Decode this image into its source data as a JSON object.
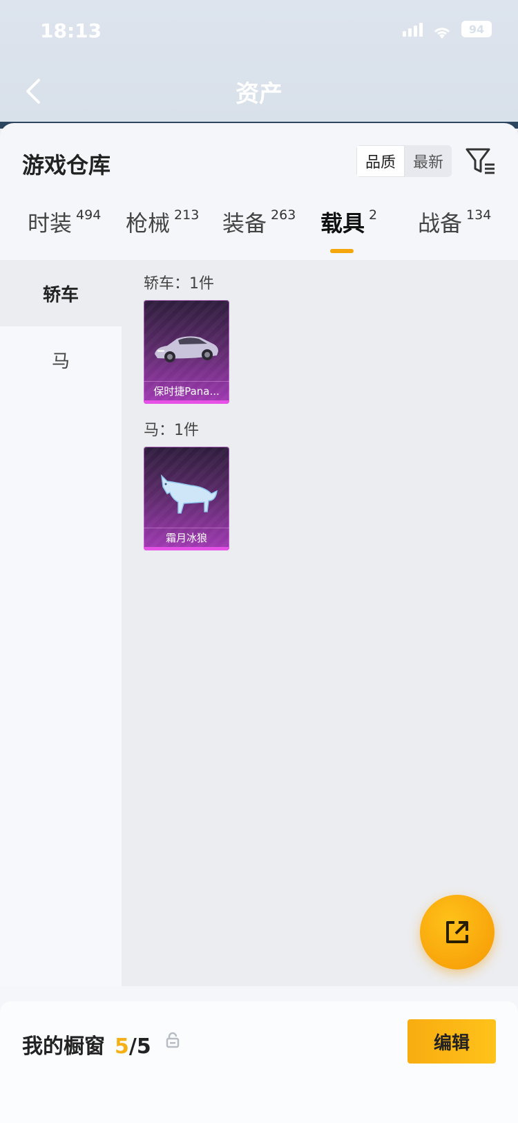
{
  "status": {
    "time": "18:13",
    "battery": "94"
  },
  "nav": {
    "title": "资产"
  },
  "warehouse": {
    "title": "游戏仓库",
    "sort_options": [
      "品质",
      "最新"
    ],
    "active_sort": "品质"
  },
  "tabs": [
    {
      "label": "时装",
      "count": "494"
    },
    {
      "label": "枪械",
      "count": "213"
    },
    {
      "label": "装备",
      "count": "263"
    },
    {
      "label": "载具",
      "count": "2"
    },
    {
      "label": "战备",
      "count": "134"
    }
  ],
  "active_tab": "载具",
  "side": [
    {
      "label": "轿车"
    },
    {
      "label": "马"
    }
  ],
  "groups": [
    {
      "label": "轿车：1件",
      "items": [
        {
          "name": "保时捷Pana..."
        }
      ]
    },
    {
      "label": "马：1件",
      "items": [
        {
          "name": "霜月冰狼"
        }
      ]
    }
  ],
  "bottom": {
    "label": "我的橱窗",
    "current": "5",
    "total": "/5",
    "edit_label": "编辑"
  },
  "colors": {
    "accent": "#f4a60c",
    "card": "#a23ab5"
  },
  "icons": [
    "back-icon",
    "filter-icon",
    "share-icon",
    "lock-icon",
    "wifi-icon",
    "signal-icon",
    "battery-icon"
  ]
}
